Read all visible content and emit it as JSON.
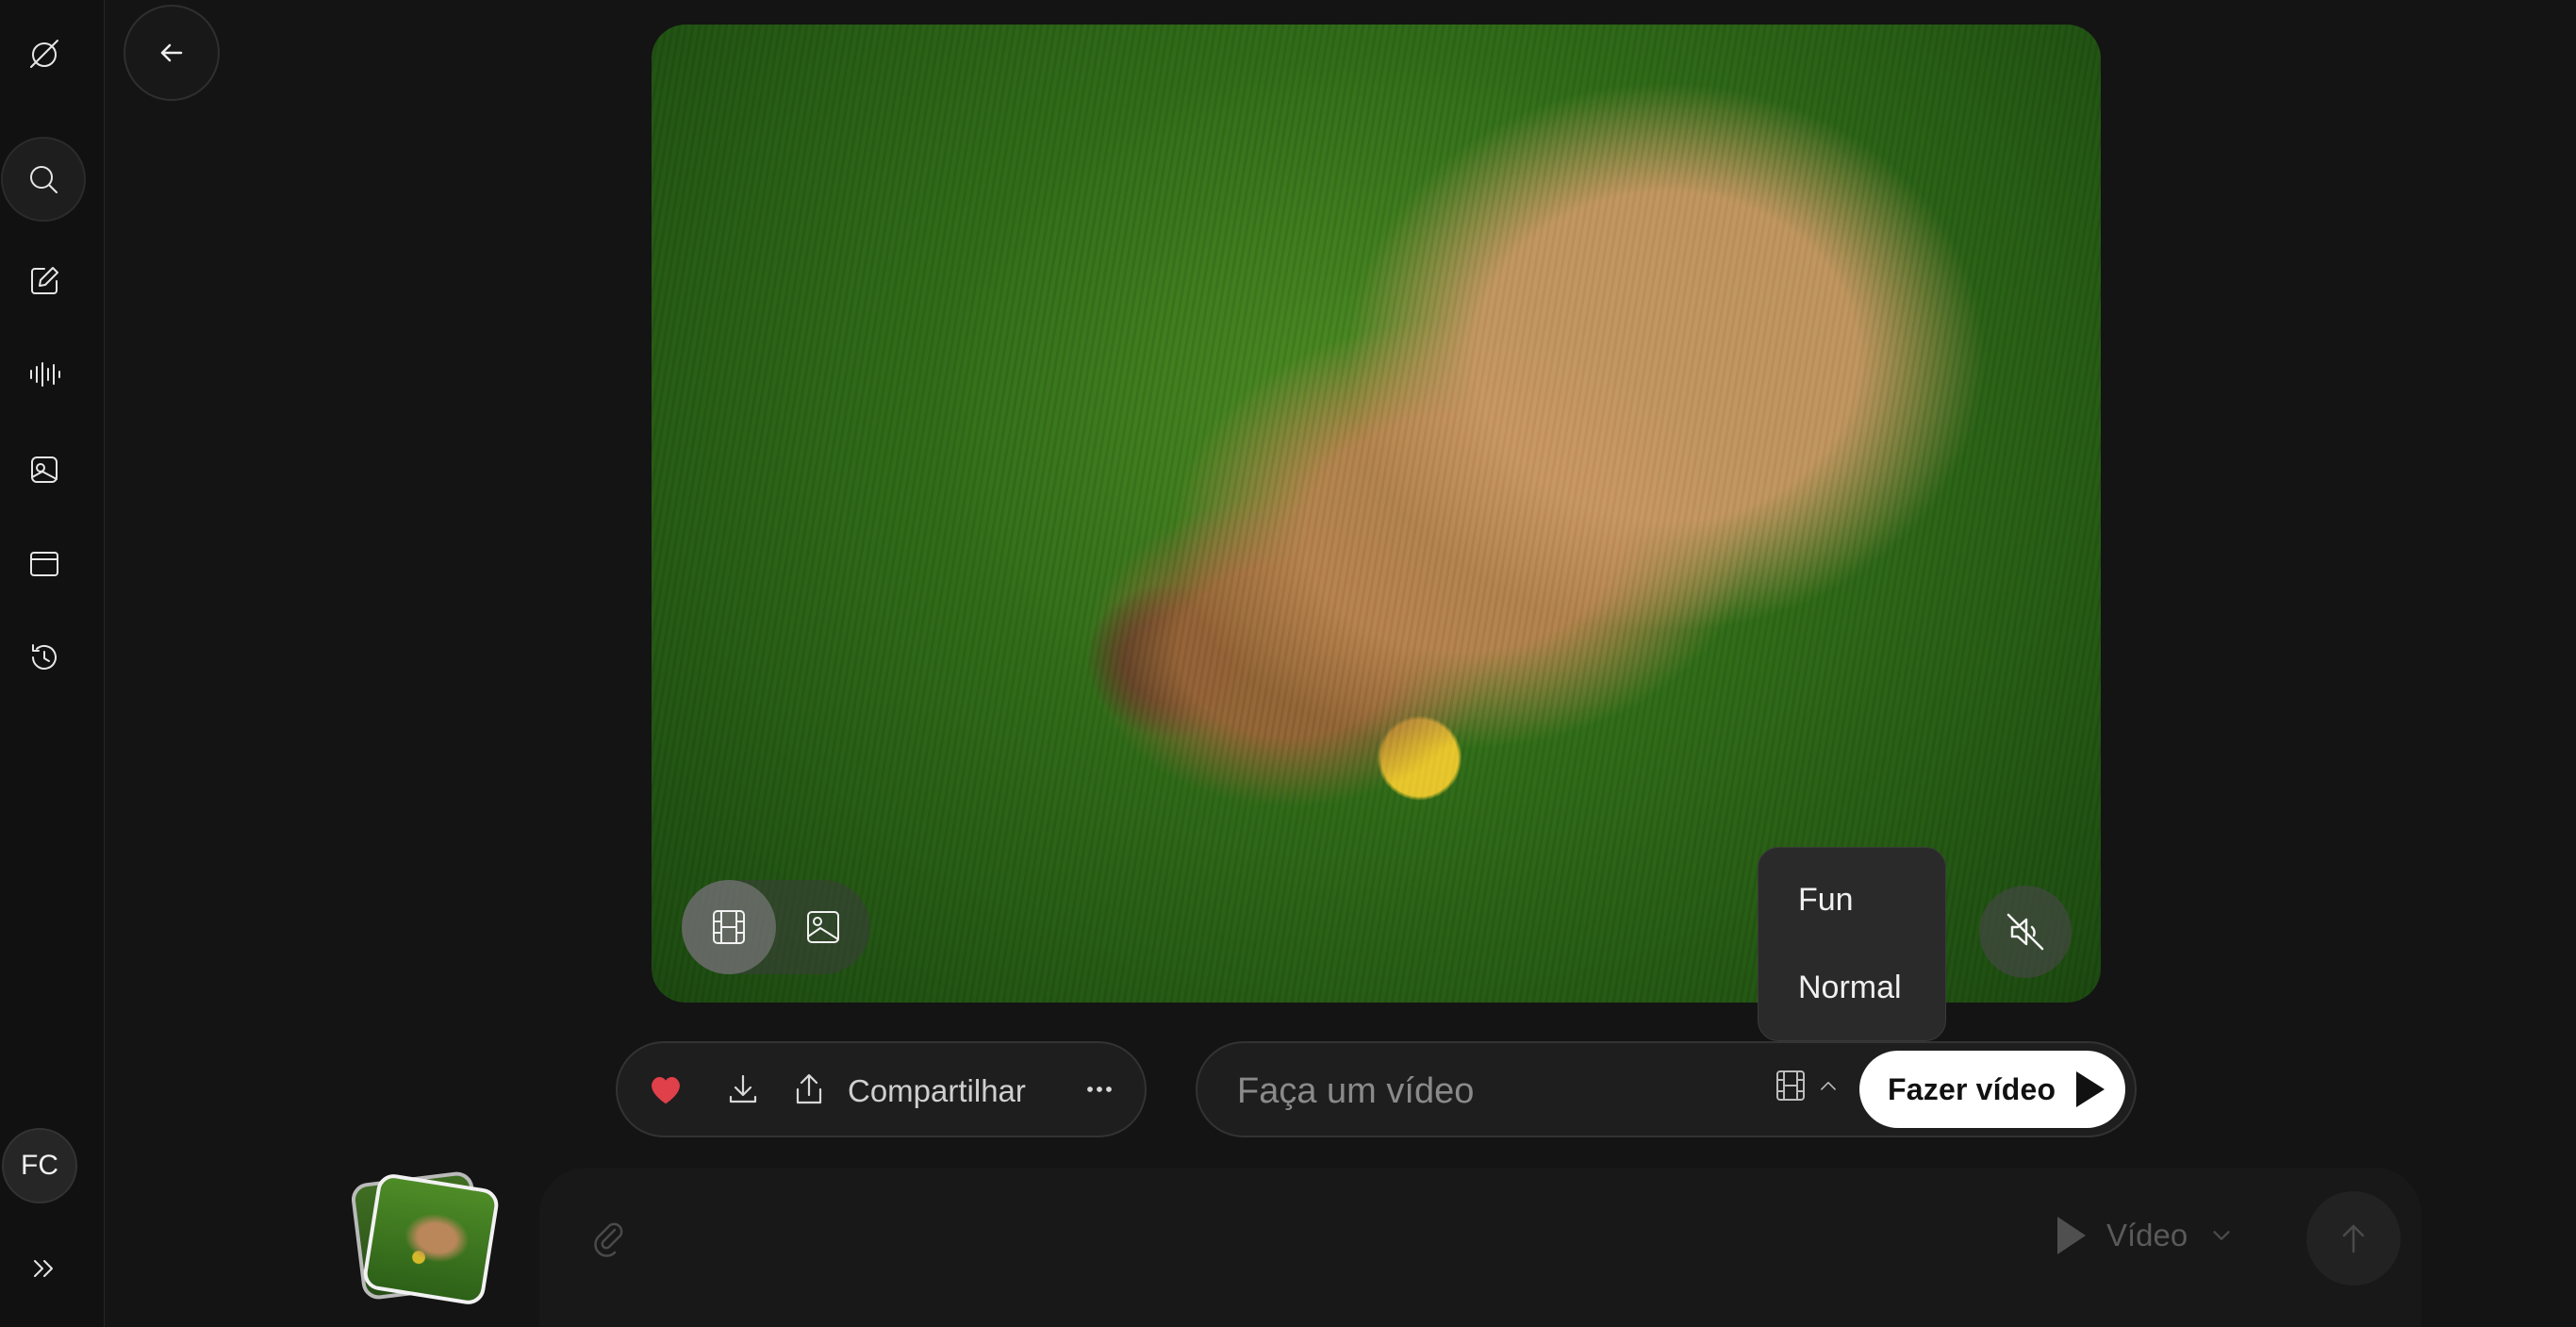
{
  "sidebar": {
    "logo_icon": "slashed-circle-logo-icon",
    "items": [
      {
        "name": "search",
        "icon": "search-icon"
      },
      {
        "name": "edit",
        "icon": "edit-icon"
      },
      {
        "name": "voice",
        "icon": "voice-wave-icon"
      },
      {
        "name": "imagine",
        "icon": "image-edit-icon"
      },
      {
        "name": "projects",
        "icon": "folder-icon"
      },
      {
        "name": "history",
        "icon": "history-icon"
      }
    ],
    "avatar_initials": "FC",
    "expand_icon": "double-chevron-right-icon"
  },
  "header": {
    "back_icon": "arrow-left-icon"
  },
  "media": {
    "mode_toggle": {
      "video_icon": "film-icon",
      "image_icon": "image-icon",
      "selected": "video"
    },
    "mute_icon": "speaker-muted-icon"
  },
  "style_menu": {
    "options": [
      "Fun",
      "Normal"
    ]
  },
  "actions": {
    "like_icon": "heart-icon",
    "download_icon": "download-icon",
    "share_icon": "share-icon",
    "share_label": "Compartilhar",
    "more_icon": "more-horizontal-icon"
  },
  "prompt": {
    "placeholder": "Faça um vídeo",
    "style_icon": "film-icon",
    "submit_label": "Fazer vídeo"
  },
  "composer": {
    "attach_icon": "paperclip-icon",
    "mode_label": "Vídeo",
    "send_icon": "arrow-up-icon"
  },
  "colors": {
    "background": "#141414",
    "heart": "#e0404a",
    "accent_button": "#ffffff"
  }
}
